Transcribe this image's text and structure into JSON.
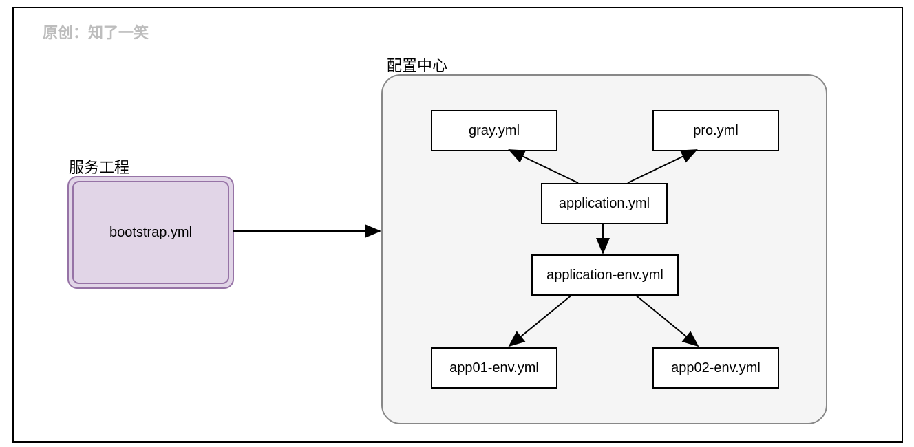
{
  "watermark": "原创：知了一笑",
  "service_title": "服务工程",
  "config_title": "配置中心",
  "nodes": {
    "bootstrap": "bootstrap.yml",
    "gray": "gray.yml",
    "pro": "pro.yml",
    "application": "application.yml",
    "application_env": "application-env.yml",
    "app01_env": "app01-env.yml",
    "app02_env": "app02-env.yml"
  }
}
